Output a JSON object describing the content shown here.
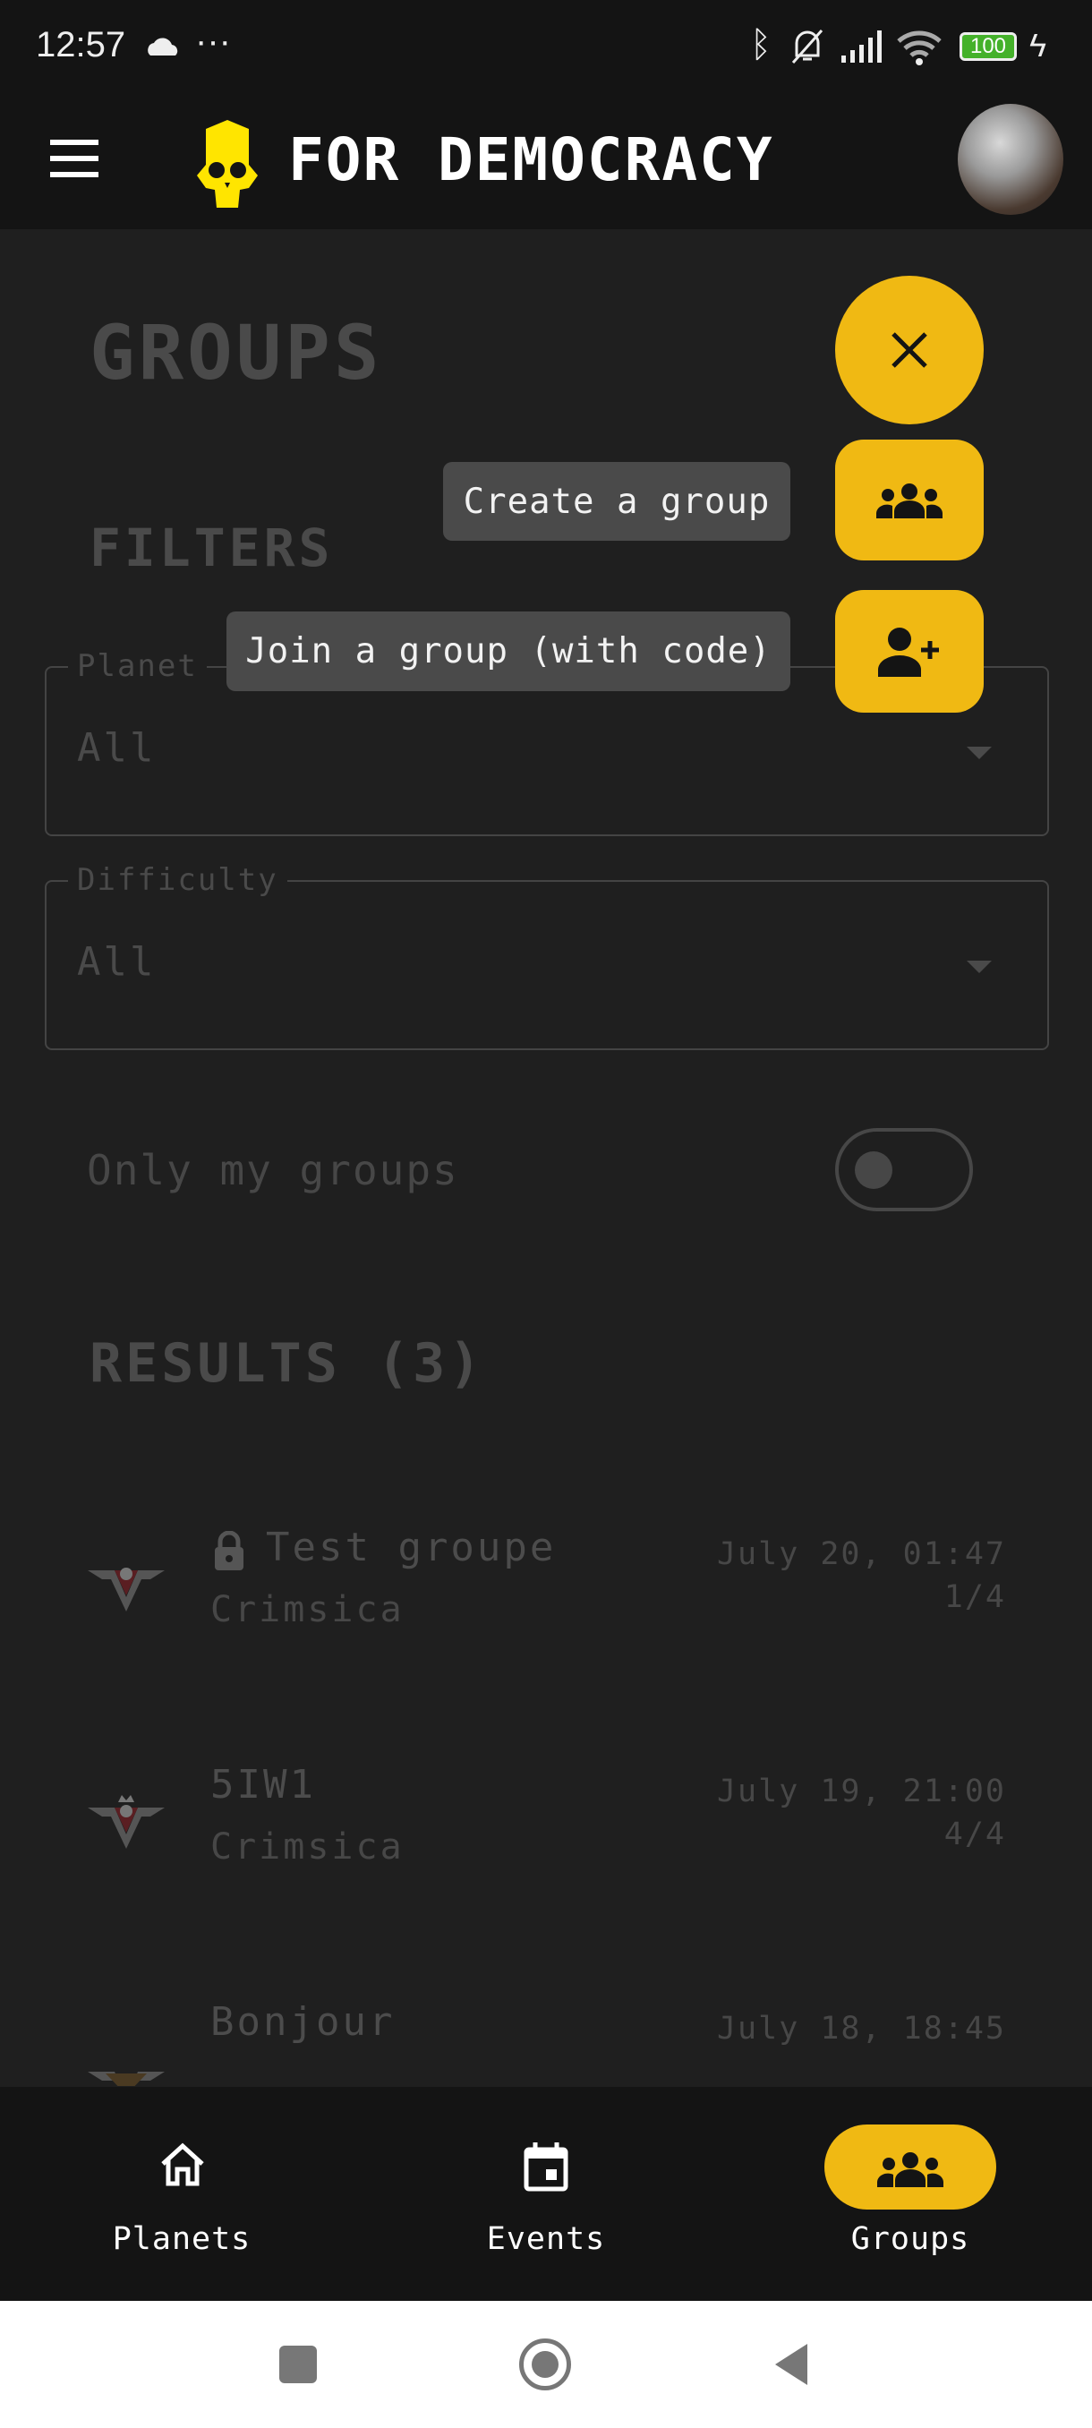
{
  "status_bar": {
    "time": "12:57",
    "dots": "···",
    "battery": "100",
    "icons": [
      "cloud-icon",
      "bluetooth-icon",
      "bell-off-icon",
      "signal-icon",
      "wifi-icon",
      "battery-icon",
      "charging-icon"
    ]
  },
  "app_bar": {
    "title": "FOR DEMOCRACY",
    "icons": [
      "menu-icon",
      "skull-logo",
      "avatar"
    ]
  },
  "page": {
    "title": "GROUPS",
    "filters_heading": "FILTERS"
  },
  "filters": {
    "planet": {
      "label": "Planet",
      "value": "All"
    },
    "difficulty": {
      "label": "Difficulty",
      "value": "All"
    },
    "only_mine": {
      "label": "Only my groups",
      "checked": false
    }
  },
  "results": {
    "heading": "RESULTS (3)",
    "items": [
      {
        "title": "Test groupe",
        "locked": true,
        "planet": "Crimsica",
        "date": "July 20, 01:47",
        "players": "1/4"
      },
      {
        "title": "5IW1",
        "locked": false,
        "planet": "Crimsica",
        "date": "July 19, 21:00",
        "players": "4/4"
      },
      {
        "title": "Bonjour",
        "locked": false,
        "date": "July 18, 18:45"
      }
    ]
  },
  "fab_menu": {
    "create_label": "Create a group",
    "join_label": "Join a group (with code)",
    "accent": "#f0b913"
  },
  "bottom_nav": {
    "items": [
      {
        "label": "Planets",
        "icon": "home-icon"
      },
      {
        "label": "Events",
        "icon": "calendar-icon"
      },
      {
        "label": "Groups",
        "icon": "groups-icon",
        "active": true
      }
    ]
  }
}
